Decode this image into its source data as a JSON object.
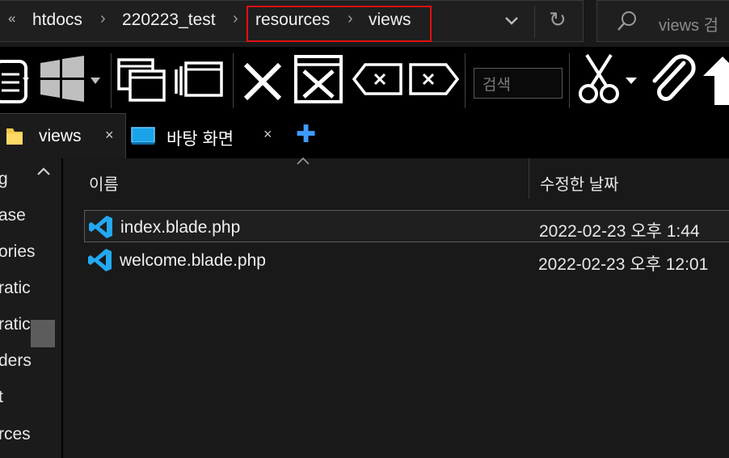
{
  "address": {
    "crumbs": [
      "htdocs",
      "220223_test",
      "resources",
      "views"
    ],
    "refresh_glyph": "↻",
    "back_glyph": "«"
  },
  "search": {
    "placeholder": "views 검"
  },
  "toolbar": {
    "search_placeholder": "검색",
    "icons": [
      "properties-icon",
      "windows-icon",
      "new-window-icon",
      "window-list-icon",
      "delete-icon",
      "close-window-icon",
      "clear-left-icon",
      "clear-right-icon",
      "scissors-icon",
      "paperclip-icon",
      "up-arrow-icon"
    ]
  },
  "tabs": [
    {
      "label": "views",
      "icon": "folder-icon",
      "close": "×"
    },
    {
      "label": "바탕 화면",
      "icon": "desktop-icon",
      "close": "×"
    }
  ],
  "tab_add": "✚",
  "nav": {
    "items": [
      "g",
      "ase",
      "ories",
      "ratic",
      "ratic",
      "ders",
      "t",
      "rces"
    ]
  },
  "columns": {
    "name": "이름",
    "modified": "수정한 날짜"
  },
  "files": [
    {
      "name": "index.blade.php",
      "modified": "2022-02-23 오후 1:44",
      "icon": "vscode-icon"
    },
    {
      "name": "welcome.blade.php",
      "modified": "2022-02-23 오후 12:01",
      "icon": "vscode-icon"
    }
  ],
  "colors": {
    "accent": "#3f9cff",
    "highlight": "#e01010",
    "vscode": "#23a9f2"
  }
}
